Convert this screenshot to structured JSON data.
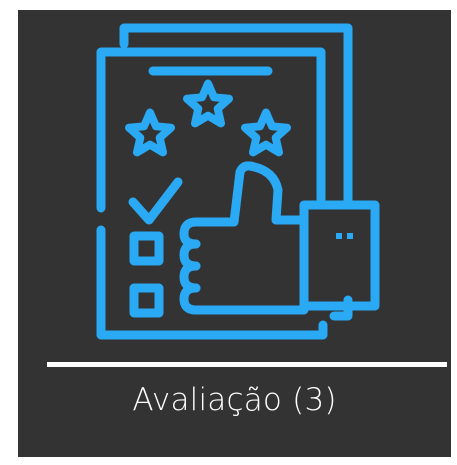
{
  "tile": {
    "label": "Avaliação (3)",
    "icon": "rating-review-thumbs-up-icon",
    "colors": {
      "background": "#333333",
      "icon": "#2aa9f4",
      "text": "#ffffff",
      "divider": "#ffffff"
    }
  }
}
